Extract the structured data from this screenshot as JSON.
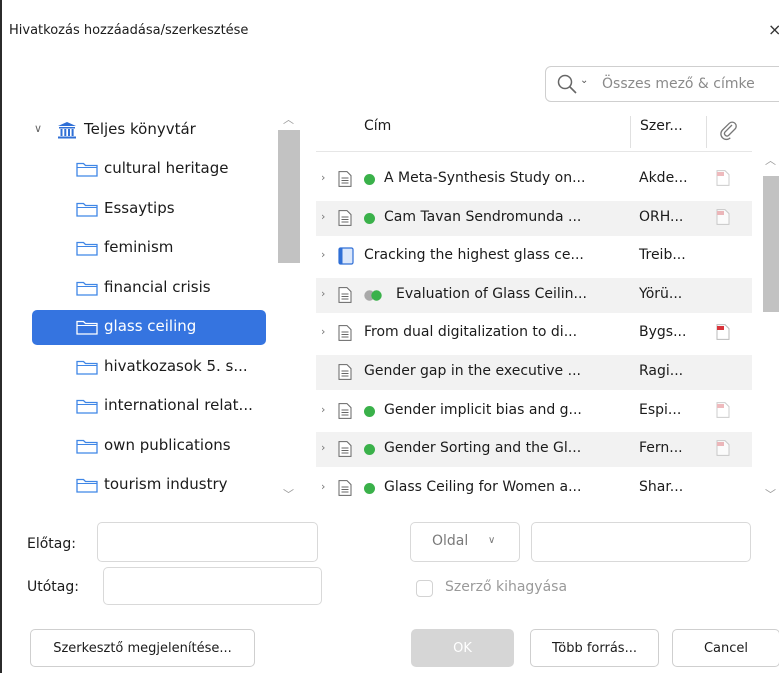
{
  "dialog": {
    "title": "Hivatkozás hozzáadása/szerkesztése",
    "close_glyph": "×"
  },
  "search": {
    "placeholder": "Összes mező & címke",
    "chevron": "⌄"
  },
  "tree": {
    "root": "Teljes könyvtár",
    "items": [
      {
        "label": "cultural heritage",
        "selected": false
      },
      {
        "label": "Essaytips",
        "selected": false
      },
      {
        "label": "feminism",
        "selected": false
      },
      {
        "label": "financial crisis",
        "selected": false
      },
      {
        "label": "glass ceiling",
        "selected": true
      },
      {
        "label": "hivatkozasok 5. s...",
        "selected": false
      },
      {
        "label": "international relat...",
        "selected": false
      },
      {
        "label": "own publications",
        "selected": false
      },
      {
        "label": "tourism industry",
        "selected": false
      }
    ]
  },
  "table": {
    "headers": {
      "title": "Cím",
      "creator": "Szer...",
      "attachment_icon": "paperclip-icon"
    },
    "rows": [
      {
        "title": "A Meta-Synthesis Study on...",
        "creator": "Akde...",
        "type": "document",
        "status": "green",
        "pdf": "faint"
      },
      {
        "title": "Cam Tavan Sendromunda ...",
        "creator": "ORH...",
        "type": "document",
        "status": "green",
        "pdf": "faint"
      },
      {
        "title": "Cracking the highest glass ce...",
        "creator": "Treib...",
        "type": "book",
        "status": "none",
        "pdf": "none"
      },
      {
        "title": "Evaluation of Glass Ceilin...",
        "creator": "Yörü...",
        "type": "document",
        "status": "half",
        "pdf": "none"
      },
      {
        "title": "From dual digitalization to di...",
        "creator": "Bygs...",
        "type": "document",
        "status": "none",
        "pdf": "red"
      },
      {
        "title": "Gender gap in the executive ...",
        "creator": "Ragi...",
        "type": "document",
        "status": "none",
        "pdf": "none"
      },
      {
        "title": "Gender implicit bias and g...",
        "creator": "Espi...",
        "type": "document",
        "status": "green",
        "pdf": "faint"
      },
      {
        "title": "Gender Sorting and the Gl...",
        "creator": "Fern...",
        "type": "document",
        "status": "green",
        "pdf": "faint"
      },
      {
        "title": "Glass Ceiling for Women a...",
        "creator": "Shar...",
        "type": "document",
        "status": "green",
        "pdf": "none"
      }
    ]
  },
  "form": {
    "prefix_label": "Előtag:",
    "suffix_label": "Utótag:",
    "locator_value": "Oldal",
    "omit_author_label": "Szerző kihagyása"
  },
  "buttons": {
    "show_editor": "Szerkesztő megjelenítése...",
    "ok": "OK",
    "multiple_sources": "Több forrás...",
    "cancel": "Cancel"
  },
  "colors": {
    "accent": "#3574e0",
    "status_green": "#3ab14a",
    "pdf_red": "#d9343b"
  }
}
